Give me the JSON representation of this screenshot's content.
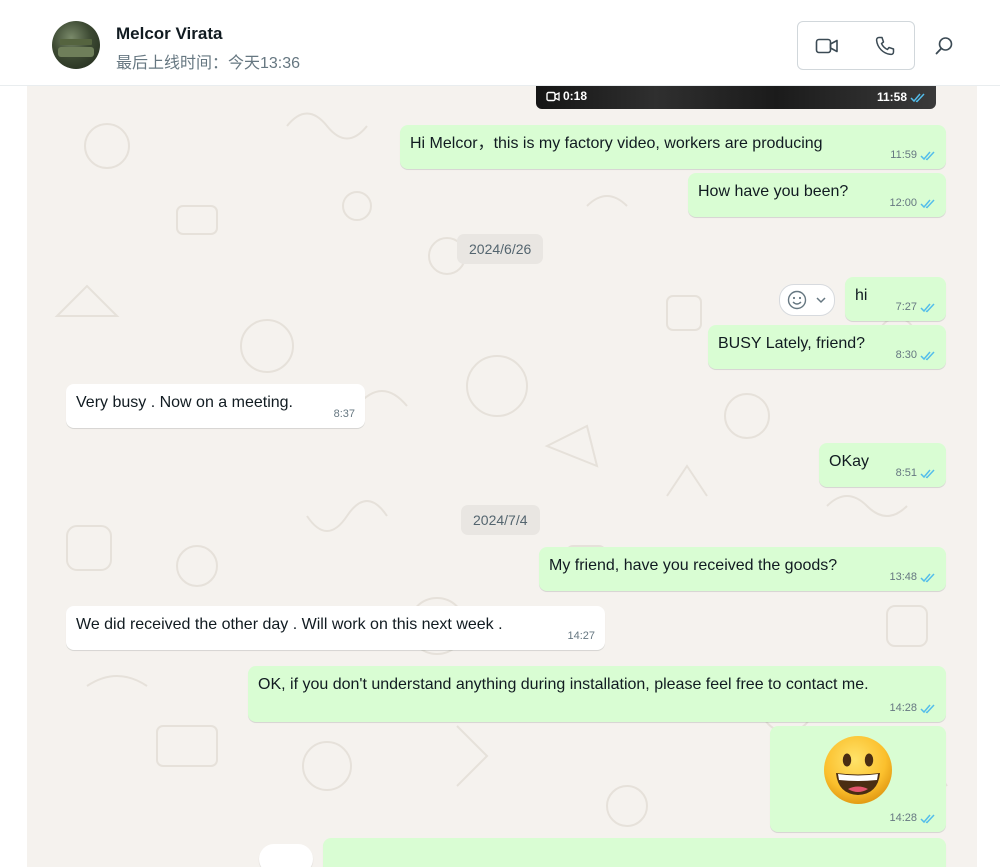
{
  "header": {
    "contact_name": "Melcor Virata",
    "last_seen": "最后上线时间：今天13:36",
    "video_call_icon": "video-camera-icon",
    "voice_call_icon": "phone-icon",
    "search_icon": "search-icon"
  },
  "chat": {
    "video_message": {
      "duration": "0:18",
      "time": "11:58"
    },
    "dates": {
      "d1": "2024/6/26",
      "d2": "2024/7/4"
    },
    "messages": [
      {
        "text": "Hi Melcor，this is my factory video, workers are producing",
        "time": "11:59",
        "direction": "out"
      },
      {
        "text": "How have you been?",
        "time": "12:00",
        "direction": "out"
      },
      {
        "text": "hi",
        "time": "7:27",
        "direction": "out"
      },
      {
        "text": "BUSY Lately, friend?",
        "time": "8:30",
        "direction": "out"
      },
      {
        "text": "Very busy . Now on a meeting.",
        "time": "8:37",
        "direction": "in"
      },
      {
        "text": "OKay",
        "time": "8:51",
        "direction": "out"
      },
      {
        "text": "My friend, have you received the goods?",
        "time": "13:48",
        "direction": "out"
      },
      {
        "text": "We did received the other day . Will work on this next week .",
        "time": "14:27",
        "direction": "in"
      },
      {
        "text": "OK, if you don't understand anything during installation, please feel free to contact me.",
        "time": "14:28",
        "direction": "out"
      },
      {
        "text": "😀",
        "time": "14:28",
        "direction": "out"
      }
    ]
  },
  "colors": {
    "outgoing_bubble": "#d9fdd3",
    "incoming_bubble": "#ffffff",
    "read_ticks": "#53bdeb",
    "chat_background": "#f5f2ee"
  }
}
